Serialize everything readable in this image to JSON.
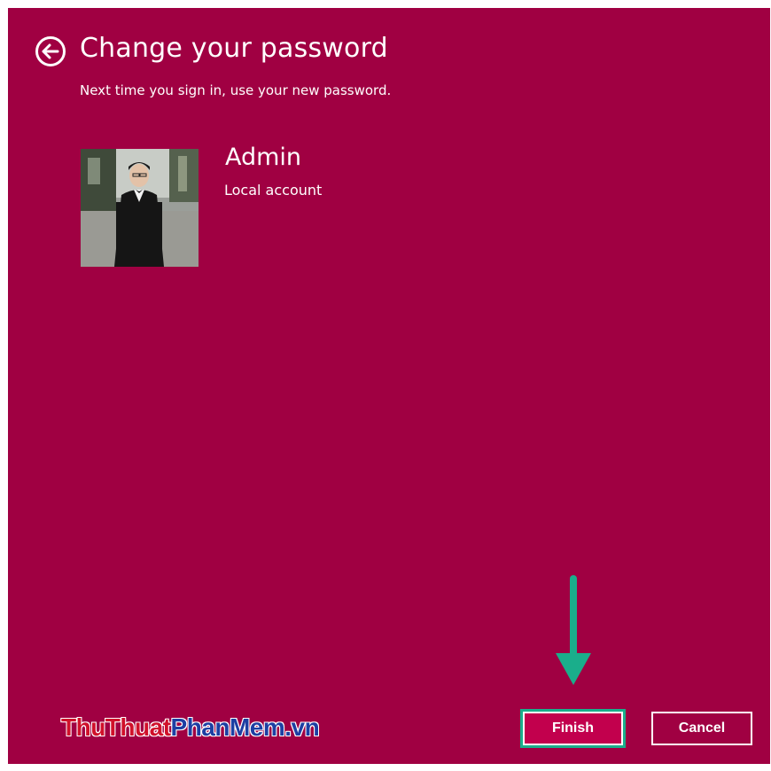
{
  "header": {
    "title": "Change your password",
    "subtitle": "Next time you sign in, use your new password."
  },
  "account": {
    "name": "Admin",
    "type": "Local account"
  },
  "watermark": {
    "part1": "ThuThuat",
    "part2": "PhanMem.vn"
  },
  "buttons": {
    "finish": "Finish",
    "cancel": "Cancel"
  },
  "icons": {
    "back": "back-arrow-circle-icon",
    "avatar": "user-photo",
    "pointer": "down-arrow-annotation"
  },
  "colors": {
    "background": "#a00042",
    "finish_button": "#c2004d",
    "highlight": "#1aae8b",
    "text": "#ffffff"
  }
}
